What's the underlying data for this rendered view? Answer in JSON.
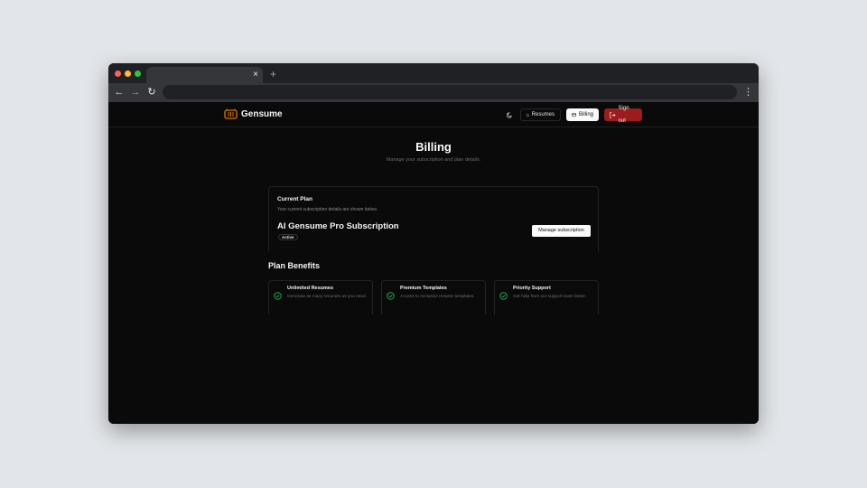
{
  "browser": {
    "tab_close": "×",
    "new_tab": "+",
    "back": "←",
    "forward": "→",
    "reload": "↻",
    "url": "",
    "menu": "⋮"
  },
  "header": {
    "brand": "Gensume",
    "theme_icon": "moon-icon",
    "nav": {
      "resumes": "Resumes",
      "billing": "Billing",
      "signout": "Sign out"
    }
  },
  "page": {
    "title": "Billing",
    "subtitle": "Manage your subscription and plan details."
  },
  "current_plan": {
    "label": "Current Plan",
    "description": "Your current subscription details are shown below.",
    "plan_name": "AI Gensume Pro Subscription",
    "status": "Active",
    "manage_button": "Manage subscription"
  },
  "benefits": {
    "heading": "Plan Benefits",
    "items": [
      {
        "title": "Unlimited Resumes",
        "description": "Generate as many resumes as you need."
      },
      {
        "title": "Premium Templates",
        "description": "Access to exclusive resume templates."
      },
      {
        "title": "Priority Support",
        "description": "Get help from our support team faster."
      }
    ]
  },
  "colors": {
    "accent_logo": "#d97706",
    "signout_bg": "#9b1c1c",
    "check_green": "#22c55e",
    "background": "#0a0a0a"
  }
}
